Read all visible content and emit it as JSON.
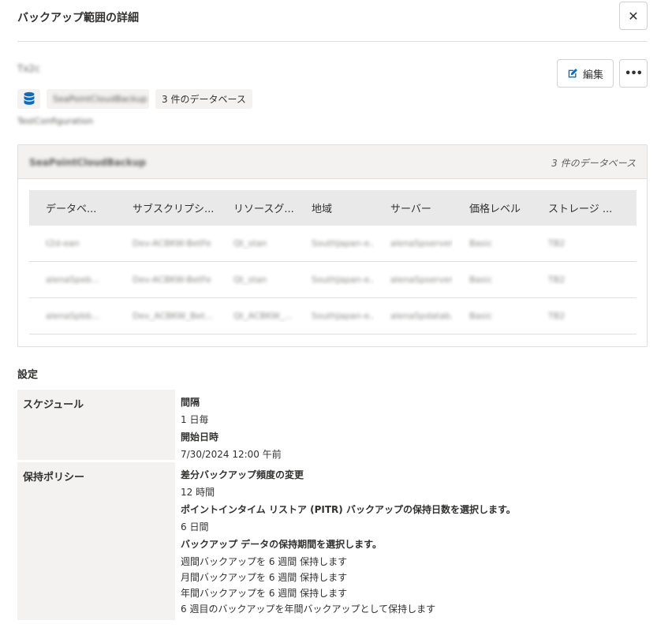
{
  "panel": {
    "title": "バックアップ範囲の詳細",
    "close_symbol": "✕",
    "more_symbol": "•••"
  },
  "scope": {
    "name": "Tx2c",
    "server_tag": "SeaPointCloudBackup",
    "db_count_tag": "3 件のデータベース",
    "configuration": "TestConfiguration",
    "db_icon": "database-icon"
  },
  "toolbar": {
    "edit_label": "編集",
    "edit_icon": "pencil-square-icon"
  },
  "db_card": {
    "server_name": "SeaPointCloudBackup",
    "count_label": "3 件のデータベース",
    "columns": [
      "データベ...",
      "サブスクリプシ...",
      "リソースグ...",
      "地域",
      "サーバー",
      "価格レベル",
      "ストレージ ..."
    ],
    "rows": [
      [
        "t2d-ean",
        "Dev-ACBKW-BetFe",
        "Qt_stan",
        "SouthJapan-e...",
        "alenaSpserver",
        "Basic",
        "TB2"
      ],
      [
        "alenaSpeb...",
        "Dev-ACBKW-BetFe",
        "Qt_stan",
        "SouthJapan-e...",
        "alenaSpserver",
        "Basic",
        "TB2"
      ],
      [
        "alenaSpbb...",
        "Dev_ACBKW_Bet...",
        "Qt_ACBKW_...",
        "SouthJapan-e...",
        "alenaSpdatab...",
        "Basic",
        "TB2"
      ]
    ]
  },
  "settings": {
    "section_title": "設定",
    "schedule": {
      "label": "スケジュール",
      "interval_label": "間隔",
      "interval_value": "1 日毎",
      "start_label": "開始日時",
      "start_value": "7/30/2024 12:00 午前"
    },
    "retention": {
      "label": "保持ポリシー",
      "diff_label": "差分バックアップ頻度の変更",
      "diff_value": "12 時間",
      "pitr_label": "ポイントインタイム リストア (PITR) バックアップの保持日数を選択します。",
      "pitr_value": "6 日間",
      "data_label": "バックアップ データの保持期間を選択します。",
      "weekly": "週間バックアップを 6 週間 保持します",
      "monthly": "月間バックアップを 6 週間 保持します",
      "yearly": "年間バックアップを 6 週間 保持します",
      "week_of_year": "6 週目のバックアップを年間バックアップとして保持します"
    }
  },
  "colors": {
    "accent": "#0f6cbd",
    "card_header": "#f3f2f1",
    "grid_header": "#e9e9ea",
    "border": "#e1dfdd"
  }
}
